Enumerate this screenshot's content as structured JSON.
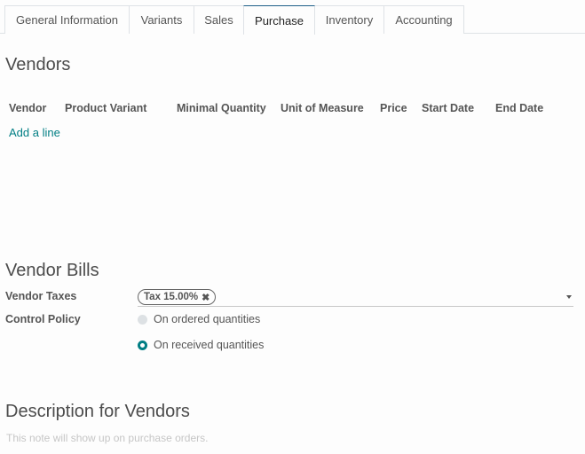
{
  "tabs": [
    {
      "label": "General Information",
      "active": false
    },
    {
      "label": "Variants",
      "active": false
    },
    {
      "label": "Sales",
      "active": false
    },
    {
      "label": "Purchase",
      "active": true
    },
    {
      "label": "Inventory",
      "active": false
    },
    {
      "label": "Accounting",
      "active": false
    }
  ],
  "vendors": {
    "title": "Vendors",
    "columns": [
      "Vendor",
      "Product Variant",
      "Minimal Quantity",
      "Unit of Measure",
      "Price",
      "Start Date",
      "End Date"
    ],
    "rows": [],
    "add_line_label": "Add a line"
  },
  "vendor_bills": {
    "title": "Vendor Bills",
    "vendor_taxes_label": "Vendor Taxes",
    "vendor_taxes_tags": [
      {
        "label": "Tax 15.00%",
        "remove_icon": "close-icon"
      }
    ],
    "control_policy_label": "Control Policy",
    "control_policy_options": [
      {
        "label": "On ordered quantities",
        "selected": false
      },
      {
        "label": "On received quantities",
        "selected": true
      }
    ]
  },
  "description": {
    "title": "Description for Vendors",
    "placeholder": "This note will show up on purchase orders."
  },
  "colors": {
    "accent": "#017e84",
    "active_tab_border": "#1e5f88"
  }
}
